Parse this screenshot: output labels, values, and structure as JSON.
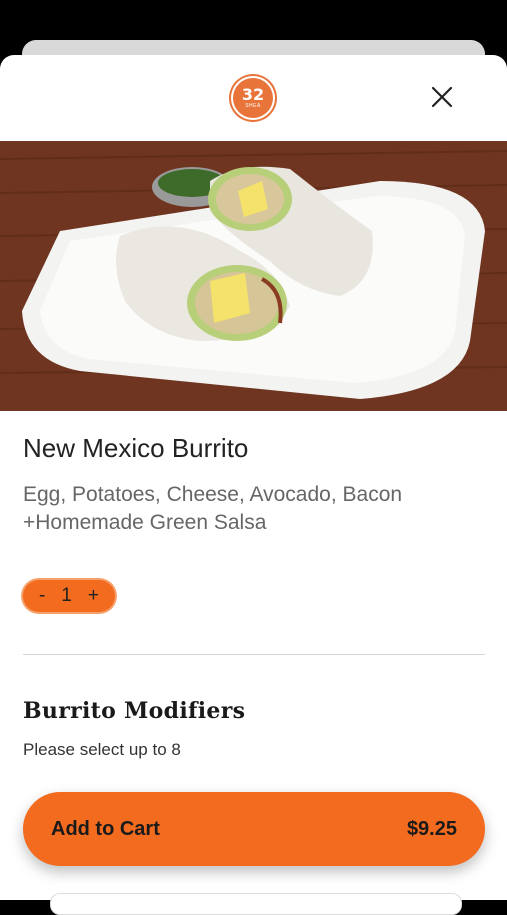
{
  "brand": {
    "logo_number": "32",
    "logo_subtext": "SHEA"
  },
  "header": {
    "close_icon": "close-icon"
  },
  "product": {
    "image_alt": "New Mexico Burrito on a white plate",
    "name": "New Mexico Burrito",
    "description": "Egg, Potatoes, Cheese, Avocado, Bacon +Homemade Green Salsa"
  },
  "quantity": {
    "minus": "-",
    "value": "1",
    "plus": "+"
  },
  "modifiers": {
    "title": "Burrito Modifiers",
    "subtitle": "Please select up to 8"
  },
  "cart": {
    "label": "Add to Cart",
    "price": "$9.25"
  },
  "colors": {
    "accent": "#f26b1f",
    "logo": "#e8743a"
  }
}
